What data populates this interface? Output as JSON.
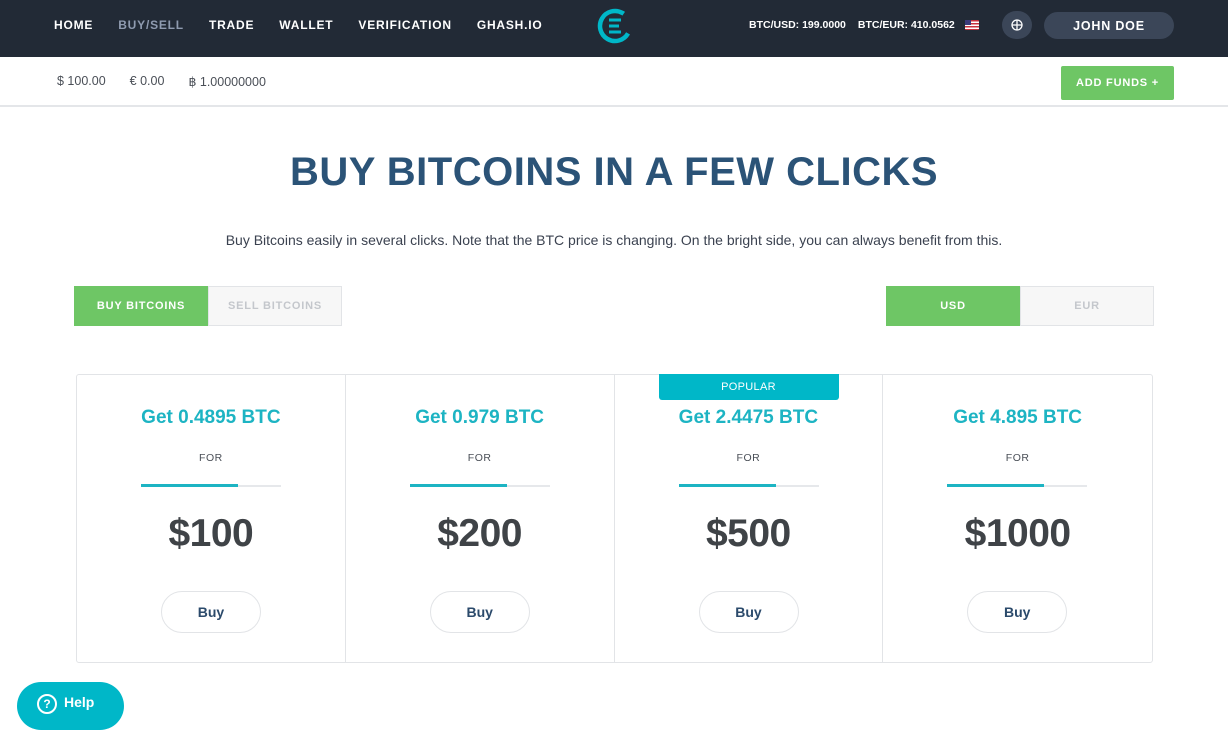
{
  "nav": {
    "items": [
      {
        "label": "HOME",
        "active": false
      },
      {
        "label": "BUY/SELL",
        "active": true
      },
      {
        "label": "TRADE",
        "active": false
      },
      {
        "label": "WALLET",
        "active": false
      },
      {
        "label": "VERIFICATION",
        "active": false
      },
      {
        "label": "GHASH.IO",
        "active": false
      }
    ],
    "logo_icon": "cex-logo-icon",
    "rate_usd": "BTC/USD: 199.0000",
    "rate_eur": "BTC/EUR: 410.0562",
    "flag_icon": "us-flag-icon",
    "globe_icon": "globe-icon",
    "user_name": "JOHN DOE"
  },
  "balances": {
    "usd": "$ 100.00",
    "eur": "€ 0.00",
    "btc": "฿ 1.00000000",
    "add_funds_label": "ADD FUNDS +"
  },
  "hero": {
    "title": "BUY BITCOINS IN A FEW CLICKS",
    "subtitle": "Buy Bitcoins easily in several clicks. Note that the BTC price is changing. On the bright side, you can always benefit from this."
  },
  "mode_toggle": {
    "buy": "BUY BITCOINS",
    "sell": "SELL BITCOINS",
    "selected": "buy"
  },
  "currency_toggle": {
    "usd": "USD",
    "eur": "EUR",
    "selected": "usd"
  },
  "offers": [
    {
      "get": "Get 0.4895 BTC",
      "for": "FOR",
      "price": "$100",
      "button": "Buy",
      "popular": ""
    },
    {
      "get": "Get 0.979 BTC",
      "for": "FOR",
      "price": "$200",
      "button": "Buy",
      "popular": ""
    },
    {
      "get": "Get 2.4475 BTC",
      "for": "FOR",
      "price": "$500",
      "button": "Buy",
      "popular": "POPULAR"
    },
    {
      "get": "Get 4.895 BTC",
      "for": "FOR",
      "price": "$1000",
      "button": "Buy",
      "popular": ""
    }
  ],
  "help": {
    "label": "Help",
    "icon": "question-icon"
  },
  "colors": {
    "nav_bg": "#222a36",
    "accent_green": "#6ec665",
    "accent_teal": "#1db4c3",
    "title_blue": "#2b5377"
  }
}
